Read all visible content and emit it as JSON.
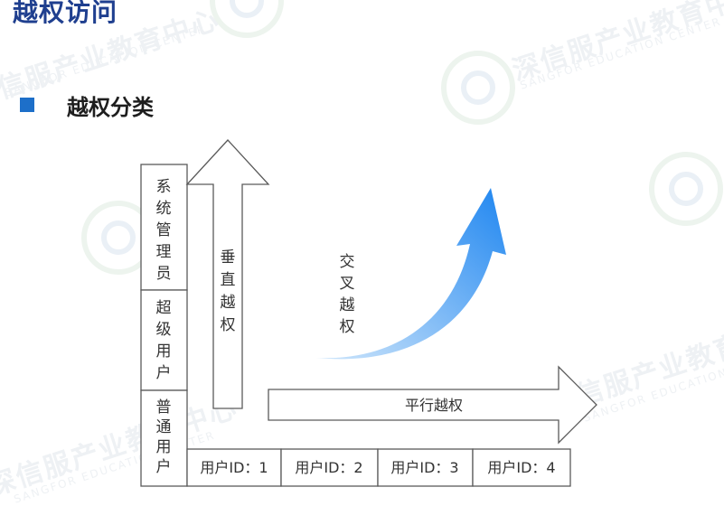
{
  "slide": {
    "title": "越权访问",
    "section_title": "越权分类"
  },
  "watermark": {
    "cn": "深信服产业教育中心",
    "en": "SANGFOR EDUCATION CENTER"
  },
  "diagram": {
    "roles": [
      {
        "id": "admin",
        "label": "系统管理员"
      },
      {
        "id": "super",
        "label": "超级用户"
      },
      {
        "id": "normal",
        "label": "普通用户"
      }
    ],
    "users": [
      "用户ID：1",
      "用户ID：2",
      "用户ID：3",
      "用户ID：4"
    ],
    "vertical_label": "垂直越权",
    "horizontal_label": "平行越权",
    "cross_label": "交叉越权",
    "colors": {
      "cross_arrow_start": "#cfe6fb",
      "cross_arrow_end": "#1f86f0"
    }
  }
}
